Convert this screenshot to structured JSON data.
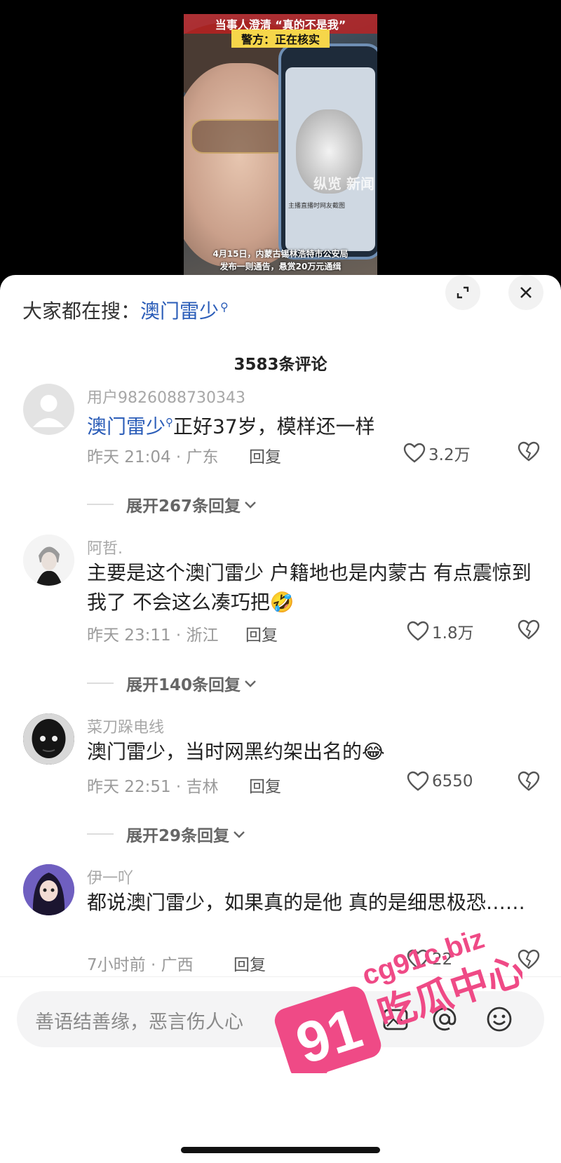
{
  "video": {
    "caption_top": "当事人澄清 “真的不是我”",
    "caption_top2": "警方：正在核实",
    "phone_watermark": "纵览 新闻",
    "phone_label": "主播直播时网友截图",
    "caption_bottom_line1": "4月15日，内蒙古锡林浩特市公安局",
    "caption_bottom_line2": "发布一则通告，悬赏20万元通缉"
  },
  "search": {
    "prefix": "大家都在搜：",
    "keyword": "澳门雷少"
  },
  "comment_count": "3583条评论",
  "comments": [
    {
      "user": "用户9826088730343",
      "keyword": "澳门雷少",
      "text": "正好37岁，模样还一样",
      "time": "昨天 21:04 · 广东",
      "reply": "回复",
      "likes": "3.2万",
      "expand": "展开267条回复"
    },
    {
      "user": "阿哲.",
      "text": "主要是这个澳门雷少 户籍地也是内蒙古 有点震惊到我了 不会这么凑巧把🤣",
      "time": "昨天 23:11 · 浙江",
      "reply": "回复",
      "likes": "1.8万",
      "expand": "展开140条回复"
    },
    {
      "user": "菜刀跺电线",
      "text": "澳门雷少，当时网黑约架出名的😂",
      "time": "昨天 22:51 · 吉林",
      "reply": "回复",
      "likes": "6550",
      "expand": "展开29条回复"
    },
    {
      "user": "伊一吖",
      "text": "都说澳门雷少，如果真的是他 真的是细思极恐……",
      "time": "7小时前 · 广西",
      "reply": "回复",
      "likes": "22"
    }
  ],
  "input": {
    "placeholder": "善语结善缘，恶言伤人心"
  },
  "watermark": {
    "number": "91",
    "domain": "cg91c.biz",
    "name": "吃瓜中心"
  },
  "colors": {
    "keyword": "#2b5db8",
    "watermark": "#ef4a86"
  }
}
